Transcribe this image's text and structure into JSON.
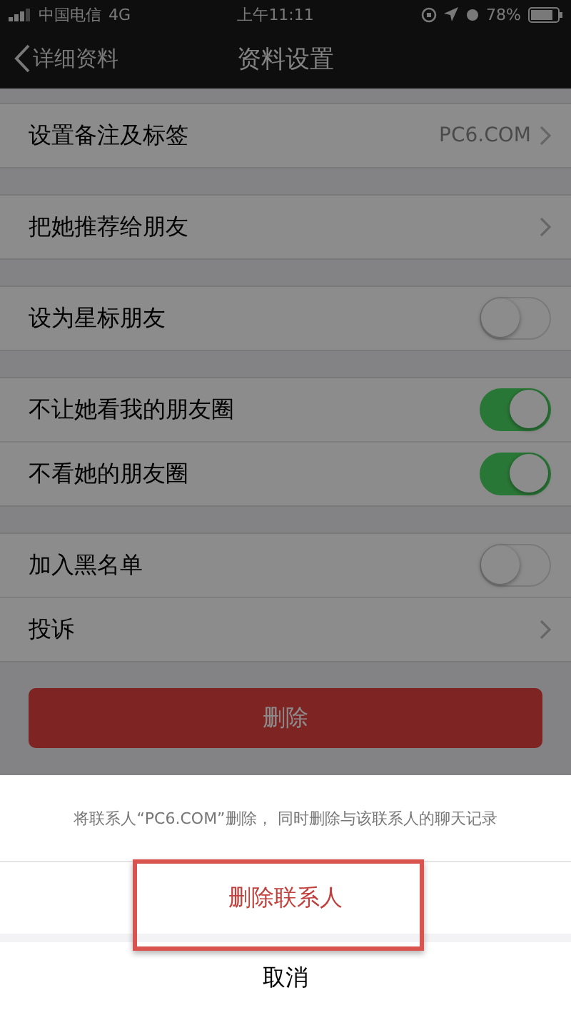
{
  "status_bar": {
    "carrier": "中国电信",
    "network": "4G",
    "time": "上午11:11",
    "battery": "78%"
  },
  "nav": {
    "back": "详细资料",
    "title": "资料设置"
  },
  "sections": [
    {
      "rows": [
        {
          "kind": "link",
          "label": "设置备注及标签",
          "value": "PC6.COM"
        }
      ]
    },
    {
      "rows": [
        {
          "kind": "link",
          "label": "把她推荐给朋友"
        }
      ]
    },
    {
      "rows": [
        {
          "kind": "toggle",
          "label": "设为星标朋友",
          "on": false
        }
      ]
    },
    {
      "rows": [
        {
          "kind": "toggle",
          "label": "不让她看我的朋友圈",
          "on": true
        },
        {
          "kind": "toggle",
          "label": "不看她的朋友圈",
          "on": true
        }
      ]
    },
    {
      "rows": [
        {
          "kind": "toggle",
          "label": "加入黑名单",
          "on": false
        },
        {
          "kind": "link",
          "label": "投诉"
        }
      ]
    }
  ],
  "delete_button": "删除",
  "action_sheet": {
    "message": "将联系人“PC6.COM”删除， 同时删除与该联系人的聊天记录",
    "confirm": "删除联系人",
    "cancel": "取消",
    "highlighted": true
  }
}
